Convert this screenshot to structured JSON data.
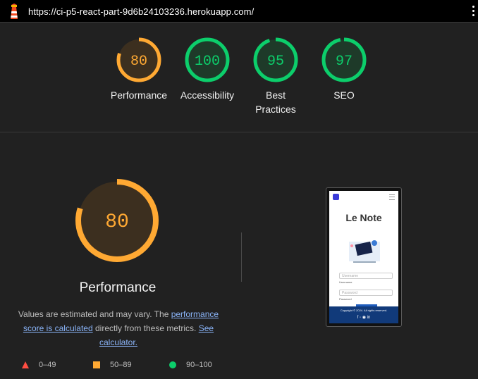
{
  "browser": {
    "url": "https://ci-p5-react-part-9d6b24103236.herokuapp.com/"
  },
  "scores": [
    {
      "value": "80",
      "label": "Performance",
      "ratio": 0.8,
      "tone": "average"
    },
    {
      "value": "100",
      "label": "Accessibility",
      "ratio": 1.0,
      "tone": "pass"
    },
    {
      "value": "95",
      "label": "Best Practices",
      "ratio": 0.95,
      "tone": "pass"
    },
    {
      "value": "97",
      "label": "SEO",
      "ratio": 0.97,
      "tone": "pass"
    }
  ],
  "colors": {
    "average": "#ffa933",
    "average_bg": "#3c2f1f",
    "pass": "#0cce6b",
    "pass_bg": "#1e3a29",
    "fail": "#ff4e42",
    "track": "#2f2f2f"
  },
  "performance": {
    "score": "80",
    "ratio": 0.8,
    "title": "Performance",
    "desc_part1": "Values are estimated and may vary. The ",
    "desc_link1": "performance score is calculated",
    "desc_part2": " directly from these metrics. ",
    "desc_link2": "See calculator."
  },
  "legend": [
    {
      "shape": "triangle",
      "range": "0–49"
    },
    {
      "shape": "square",
      "range": "50–89"
    },
    {
      "shape": "circle",
      "range": "90–100"
    }
  ],
  "screenshot": {
    "title": "Le Note",
    "username_placeholder": "Username",
    "username_label": "Username",
    "password_placeholder": "Password",
    "password_label": "Password",
    "copyright": "Copyright © 2024. All rights reserved."
  }
}
